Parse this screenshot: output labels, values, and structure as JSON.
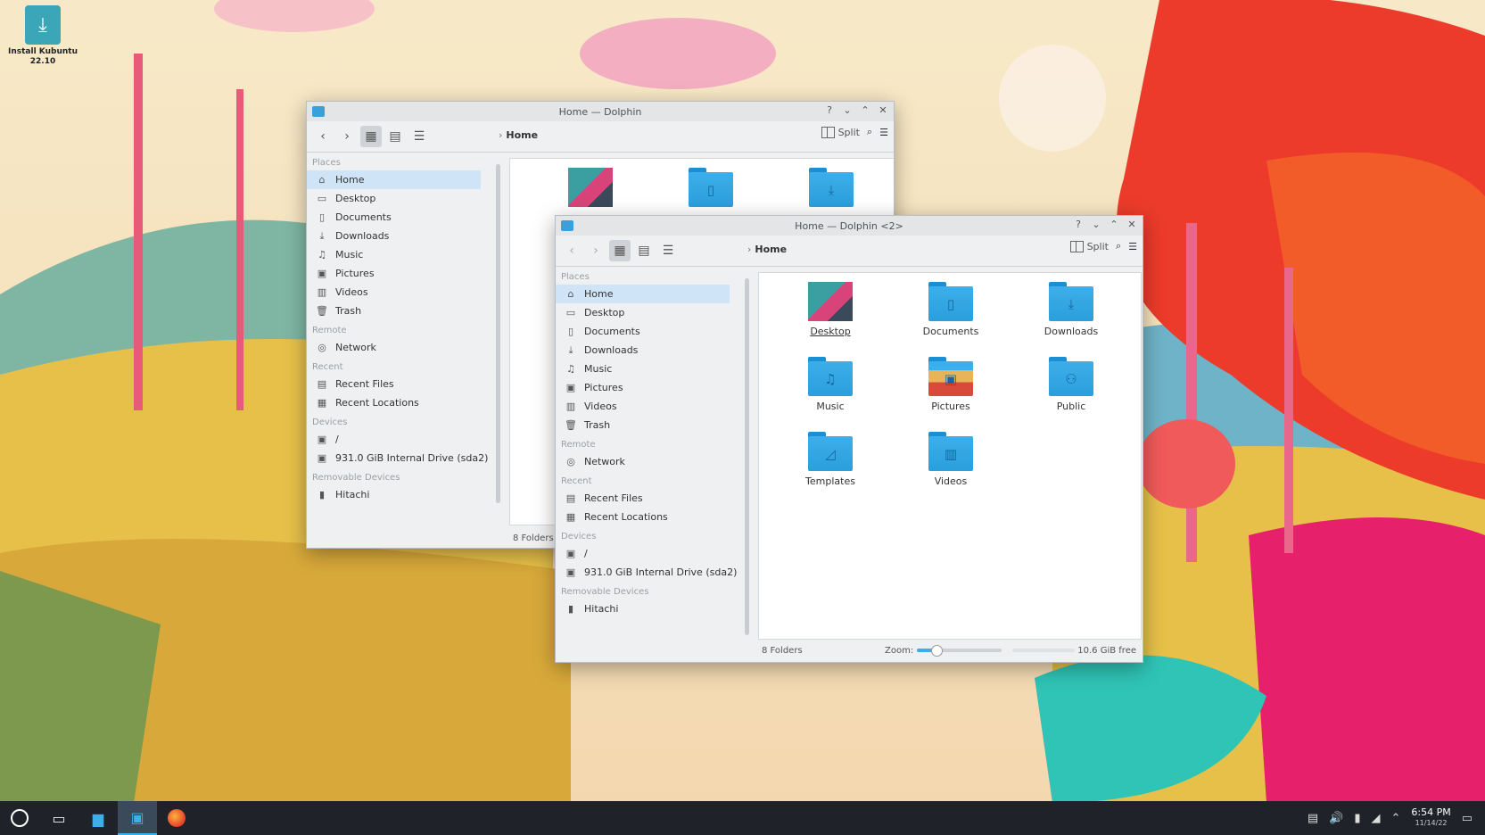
{
  "desktop": {
    "install_icon_label": "Install Kubuntu 22.10"
  },
  "back_window": {
    "title": "Home — Dolphin",
    "breadcrumb": "Home",
    "split_label": "Split",
    "status": "8 Folders",
    "places_header": "Places",
    "places": [
      "Home",
      "Desktop",
      "Documents",
      "Downloads",
      "Music",
      "Pictures",
      "Videos",
      "Trash"
    ],
    "remote_header": "Remote",
    "remote": [
      "Network"
    ],
    "recent_header": "Recent",
    "recent": [
      "Recent Files",
      "Recent Locations"
    ],
    "devices_header": "Devices",
    "devices": [
      "/",
      "931.0 GiB Internal Drive (sda2)"
    ],
    "removable_header": "Removable Devices",
    "removable": [
      "Hitachi"
    ]
  },
  "front_window": {
    "title": "Home — Dolphin <2>",
    "breadcrumb": "Home",
    "split_label": "Split",
    "places_header": "Places",
    "places": [
      "Home",
      "Desktop",
      "Documents",
      "Downloads",
      "Music",
      "Pictures",
      "Videos",
      "Trash"
    ],
    "remote_header": "Remote",
    "remote": [
      "Network"
    ],
    "recent_header": "Recent",
    "recent": [
      "Recent Files",
      "Recent Locations"
    ],
    "devices_header": "Devices",
    "devices": [
      "/",
      "931.0 GiB Internal Drive (sda2)"
    ],
    "removable_header": "Removable Devices",
    "removable": [
      "Hitachi"
    ],
    "folders": [
      "Desktop",
      "Documents",
      "Downloads",
      "Music",
      "Pictures",
      "Public",
      "Templates",
      "Videos"
    ],
    "status_count": "8 Folders",
    "zoom_label": "Zoom:",
    "zoom_level": 0.22,
    "free_space": "10.6 GiB free"
  },
  "taskbar": {
    "clock_time": "6:54 PM",
    "clock_date": "11/14/22"
  },
  "colors": {
    "accent": "#3daee9",
    "selection": "#cfe4f7",
    "taskbar": "#1f2329"
  }
}
